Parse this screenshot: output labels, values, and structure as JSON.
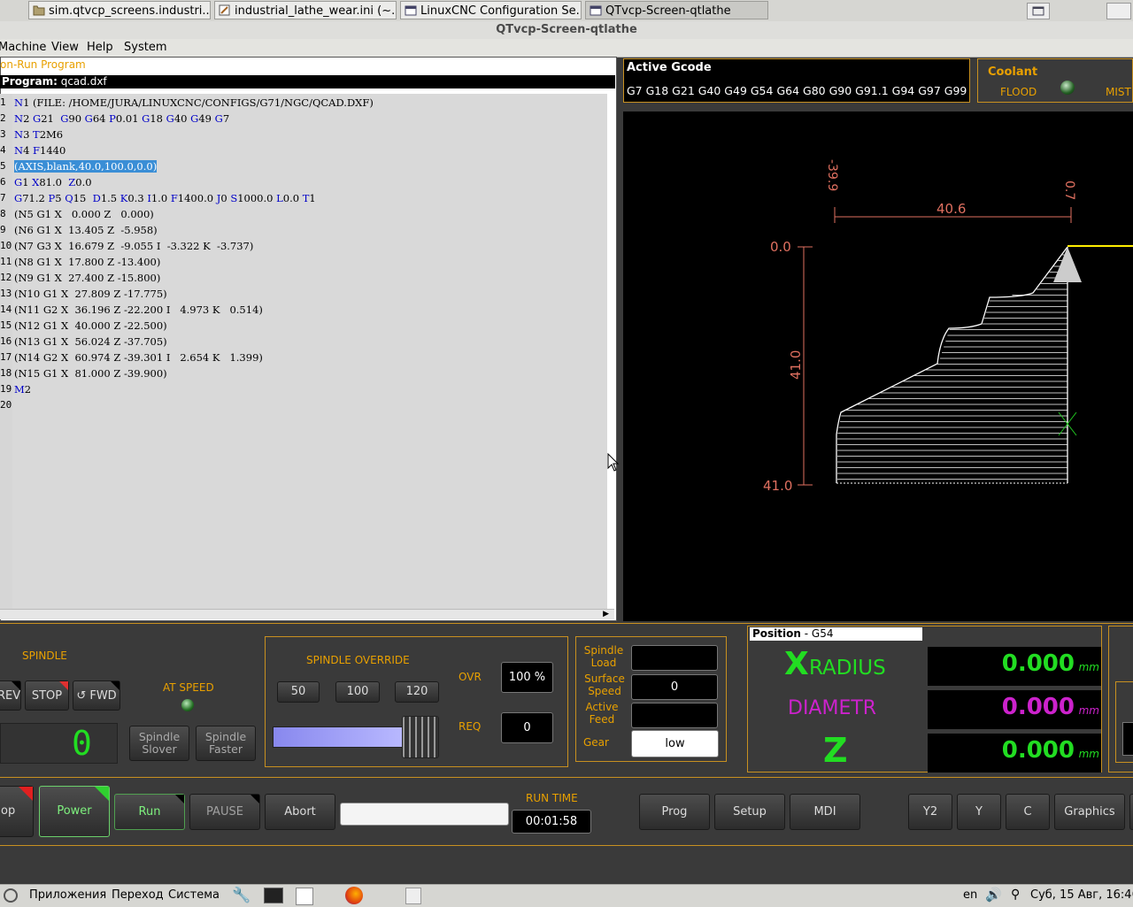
{
  "taskbar": {
    "tasks": [
      {
        "label": "sim.qtvcp_screens.industri..."
      },
      {
        "label": "industrial_lathe_wear.ini (~..."
      },
      {
        "label": "LinuxCNC Configuration Se..."
      },
      {
        "label": "QTvcp-Screen-qtlathe"
      }
    ]
  },
  "window": {
    "title": "QTvcp-Screen-qtlathe"
  },
  "menu": {
    "items": [
      "Machine",
      "View",
      "Help",
      "System"
    ]
  },
  "editor": {
    "run_from_label": "on-Run Program",
    "program_label": "Program:",
    "program_file": "qcad.dxf",
    "lines": [
      {
        "n": "1",
        "text": "N1 (FILE: /HOME/JURA/LINUXCNC/CONFIGS/G71/NGC/QCAD.DXF)"
      },
      {
        "n": "2",
        "text": "N2 G21  G90 G64 P0.01 G18 G40 G49 G7"
      },
      {
        "n": "3",
        "text": "N3 T2M6"
      },
      {
        "n": "4",
        "text": "N4 F1440"
      },
      {
        "n": "5",
        "text": "(AXIS,blank,40.0,100.0,0.0)"
      },
      {
        "n": "6",
        "text": "G1 X81.0  Z0.0"
      },
      {
        "n": "7",
        "text": "G71.2 P5 Q15  D1.5 K0.3 I1.0 F1400.0 J0 S1000.0 L0.0 T1"
      },
      {
        "n": "8",
        "text": "(N5 G1 X   0.000 Z   0.000)"
      },
      {
        "n": "9",
        "text": "(N6 G1 X  13.405 Z  -5.958)"
      },
      {
        "n": "10",
        "text": "(N7 G3 X  16.679 Z  -9.055 I  -3.322 K  -3.737)"
      },
      {
        "n": "11",
        "text": "(N8 G1 X  17.800 Z -13.400)"
      },
      {
        "n": "12",
        "text": "(N9 G1 X  27.400 Z -15.800)"
      },
      {
        "n": "13",
        "text": "(N10 G1 X  27.809 Z -17.775)"
      },
      {
        "n": "14",
        "text": "(N11 G2 X  36.196 Z -22.200 I   4.973 K   0.514)"
      },
      {
        "n": "15",
        "text": "(N12 G1 X  40.000 Z -22.500)"
      },
      {
        "n": "16",
        "text": "(N13 G1 X  56.024 Z -37.705)"
      },
      {
        "n": "17",
        "text": "(N14 G2 X  60.974 Z -39.301 I   2.654 K   1.399)"
      },
      {
        "n": "18",
        "text": "(N15 G1 X  81.000 Z -39.900)"
      },
      {
        "n": "19",
        "text": "M2"
      },
      {
        "n": "20",
        "text": ""
      }
    ]
  },
  "active_gcode": {
    "title": "Active Gcode",
    "codes": "G7 G18 G21 G40 G49 G54 G64 G80 G90 G91.1 G94 G97 G99"
  },
  "coolant": {
    "title": "Coolant",
    "flood": "FLOOD",
    "mist": "MIST"
  },
  "graphics": {
    "dim_top_left": "-39.9",
    "dim_top_right": "0.7",
    "dim_width": "40.6",
    "dim_z_top": "0.0",
    "dim_z_bottom": "41.0",
    "dim_height": "41.0"
  },
  "spindle": {
    "title": "SPINDLE",
    "rev": "REV",
    "stop": "STOP",
    "fwd": "FWD",
    "at_speed": "AT SPEED",
    "slower": "Spindle\nSlover",
    "faster": "Spindle\nFaster",
    "digit": "0"
  },
  "spindle_override": {
    "title": "SPINDLE OVERRIDE",
    "presets": [
      "50",
      "100",
      "120"
    ],
    "ovr_label": "OVR",
    "ovr_value": "100 %",
    "req_label": "REQ",
    "req_value": "0",
    "slider_level_percent": 100
  },
  "spindle_info": {
    "load_label": "Spindle\nLoad",
    "load_value": "",
    "surface_label": "Surface\nSpeed",
    "surface_value": "0",
    "feed_label": "Active\nFeed",
    "feed_value": "",
    "gear_label": "Gear",
    "gear_value": "low"
  },
  "position": {
    "title": "Position",
    "coord": " - G54",
    "x_letter": "X",
    "x_label": "RADIUS",
    "x_value": "0.000",
    "diam_label": "DIAMETR",
    "diam_value": "0.000",
    "z_letter": "Z",
    "z_value": "0.000",
    "unit": "mm",
    "colors": {
      "x": "#22dd22",
      "diam": "#cc22cc",
      "z": "#22dd22"
    }
  },
  "controls": {
    "estop": "op",
    "power": "Power",
    "run": "Run",
    "pause": "PAUSE",
    "abort": "Abort",
    "mdi_input": "",
    "run_time_label": "RUN TIME",
    "run_time": "00:01:58",
    "prog": "Prog",
    "setup": "Setup",
    "mdi": "MDI",
    "y2": "Y2",
    "y": "Y",
    "c": "C",
    "graphics": "Graphics"
  },
  "statusbar": {
    "apps": "Приложения",
    "goto": "Переход",
    "system": "Система",
    "lang": "en",
    "datetime": "Суб, 15 Авг, 16:46"
  }
}
